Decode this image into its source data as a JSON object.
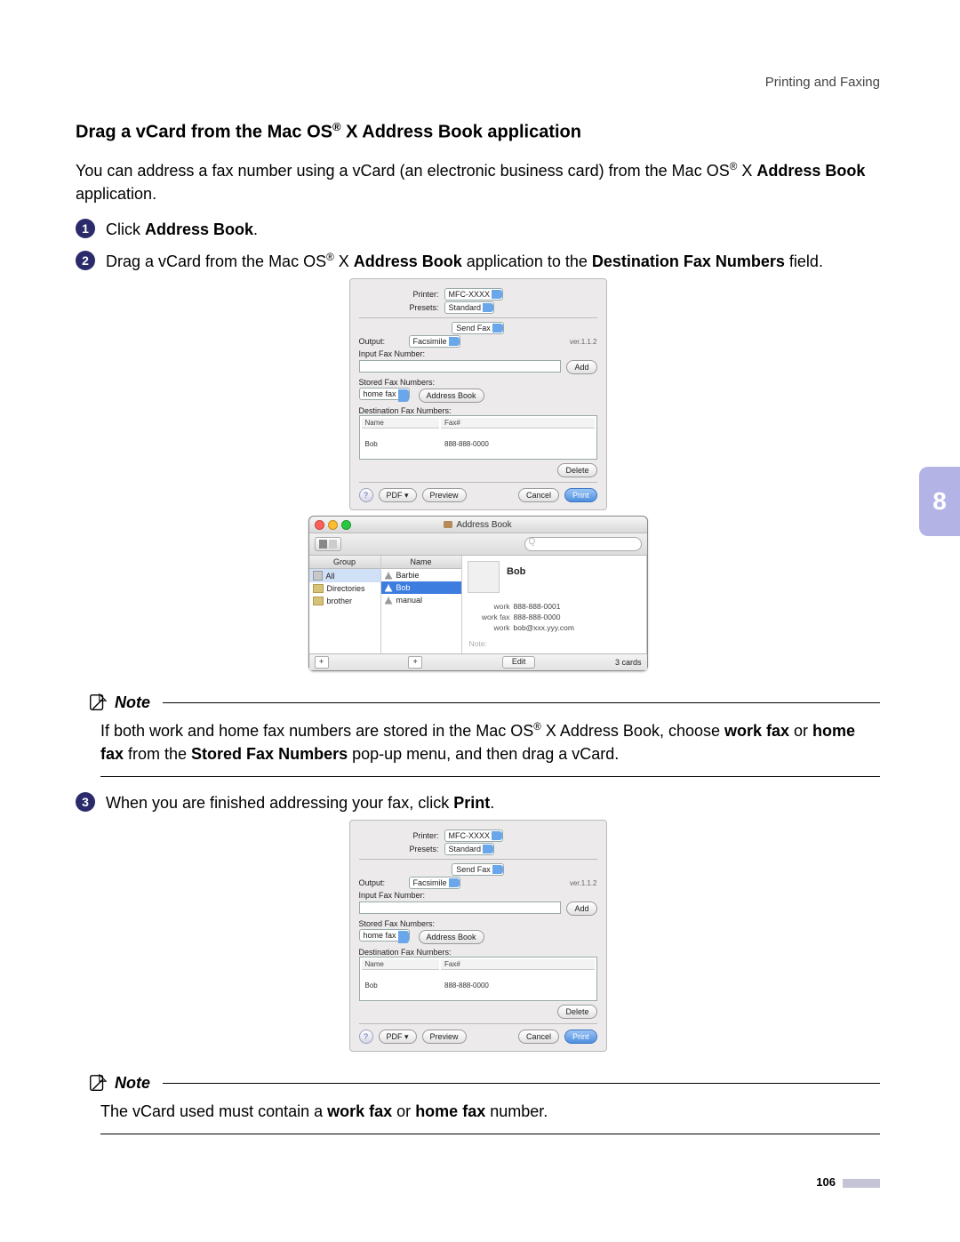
{
  "header": {
    "section": "Printing and Faxing"
  },
  "chapter": "8",
  "heading": "Drag a vCard from the Mac OS® X Address Book application",
  "intro": {
    "pre": "You can address a fax number using a vCard (an electronic business card) from the Mac OS",
    "reg": "®",
    "mid": " X ",
    "bold": "Address Book",
    "post": " application."
  },
  "steps": {
    "s1": {
      "num": "1",
      "pre": "Click ",
      "bold": "Address Book",
      "post": "."
    },
    "s2": {
      "num": "2",
      "pre": "Drag a vCard from the Mac OS",
      "reg": "®",
      "a": " X ",
      "b1": "Address Book",
      "b": " application to the ",
      "b2": "Destination Fax Numbers",
      "post": " field."
    },
    "s3": {
      "num": "3",
      "pre": "When you are finished addressing your fax, click ",
      "bold": "Print",
      "post": "."
    }
  },
  "notes": {
    "label": "Note",
    "n1": {
      "pre": "If both work and home fax numbers are stored in the Mac OS",
      "reg": "®",
      "a": " X Address Book, choose ",
      "b1": "work fax",
      "or": " or ",
      "b2": "home fax",
      "mid": " from the ",
      "b3": "Stored Fax Numbers",
      "post": " pop-up menu, and then drag a vCard."
    },
    "n2": {
      "pre": "The vCard used must contain a ",
      "b1": "work fax",
      "or": " or ",
      "b2": "home fax",
      "post": " number."
    }
  },
  "dialog": {
    "printer_lbl": "Printer:",
    "printer_val": "MFC-XXXX",
    "presets_lbl": "Presets:",
    "presets_val": "Standard",
    "pane_val": "Send Fax",
    "output_lbl": "Output:",
    "output_val": "Facsimile",
    "version": "ver.1.1.2",
    "input_lbl": "Input Fax Number:",
    "add_btn": "Add",
    "stored_lbl": "Stored Fax Numbers:",
    "stored_val": "home fax",
    "ab_btn": "Address Book",
    "dest_lbl": "Destination Fax Numbers:",
    "col_name": "Name",
    "col_fax": "Fax#",
    "row_name": "Bob",
    "row_fax": "888-888-0000",
    "delete_btn": "Delete",
    "help": "?",
    "pdf_btn": "PDF ▾",
    "preview_btn": "Preview",
    "cancel_btn": "Cancel",
    "print_btn": "Print"
  },
  "abook": {
    "title": "Address Book",
    "group_head": "Group",
    "name_head": "Name",
    "groups": [
      "All",
      "Directories",
      "brother"
    ],
    "names": [
      "Barbie",
      "Bob",
      "manual"
    ],
    "card_name": "Bob",
    "lines": [
      {
        "label": "work",
        "value": "888-888-0001"
      },
      {
        "label": "work fax",
        "value": "888-888-0000"
      },
      {
        "label": "work",
        "value": "bob@xxx.yyy.com"
      }
    ],
    "note_lbl": "Note:",
    "edit": "Edit",
    "count": "3 cards"
  },
  "page_number": "106"
}
